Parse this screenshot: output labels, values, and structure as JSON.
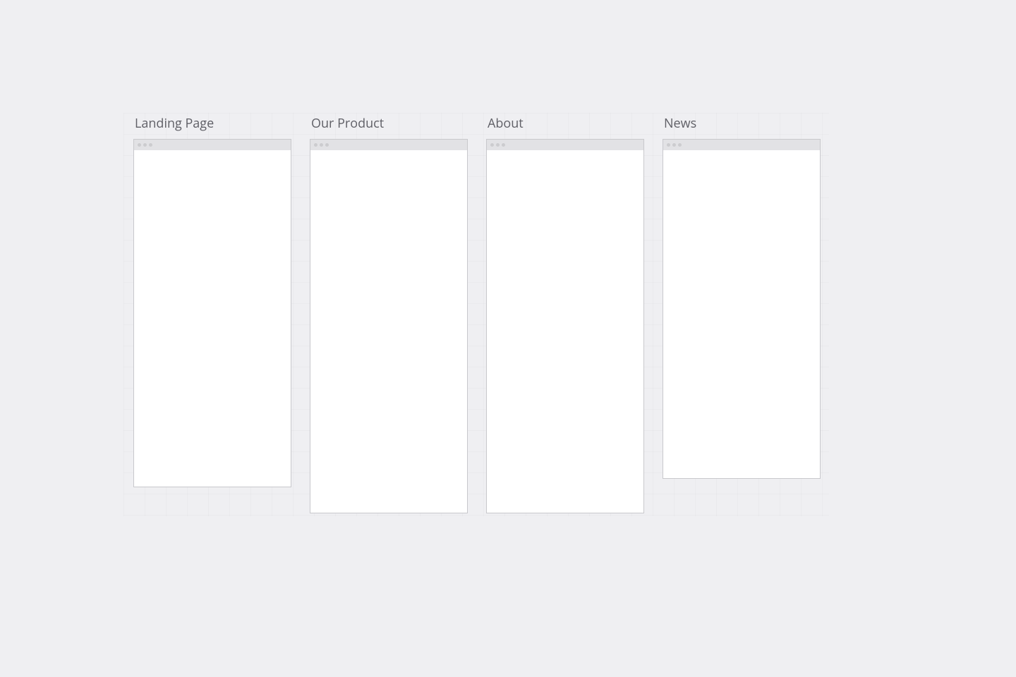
{
  "pages": [
    {
      "title": "Landing Page",
      "frame_height_class": "h-494"
    },
    {
      "title": "Our Product",
      "frame_height_class": "h-531"
    },
    {
      "title": "About",
      "frame_height_class": "h-531"
    },
    {
      "title": "News",
      "frame_height_class": "h-482"
    }
  ]
}
